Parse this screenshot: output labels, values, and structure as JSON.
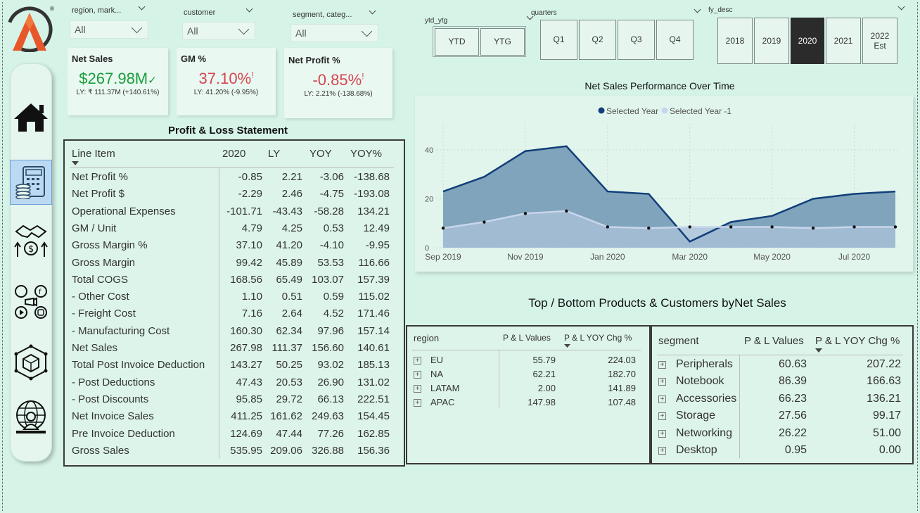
{
  "filters": {
    "region": {
      "label": "region, mark...",
      "value": "All"
    },
    "customer": {
      "label": "customer",
      "value": "All"
    },
    "segment": {
      "label": "segment, categ...",
      "value": "All"
    },
    "ytd_ytg": {
      "label": "ytd_ytg",
      "options": [
        "YTD",
        "YTG"
      ]
    },
    "quarters": {
      "label": "quarters",
      "options": [
        "Q1",
        "Q2",
        "Q3",
        "Q4"
      ]
    },
    "fy_desc": {
      "label": "fy_desc",
      "options": [
        "2018",
        "2019",
        "2020",
        "2021",
        "2022 Est"
      ],
      "selected": "2020"
    }
  },
  "kpis": {
    "net_sales": {
      "title": "Net Sales",
      "value": "$267.98M",
      "status": "✓",
      "ly": "LY: ₹ 111.37M (+140.61%)",
      "color": "#1a9d3c"
    },
    "gm_pct": {
      "title": "GM %",
      "value": "37.10%",
      "status": "!",
      "ly": "LY: 41.20% (-9.95%)",
      "color": "#d64550"
    },
    "net_profit_pct": {
      "title": "Net Profit %",
      "value": "-0.85%",
      "status": "!",
      "ly": "LY: 2.21% (-138.68%)",
      "color": "#d64550"
    }
  },
  "pl": {
    "title": "Profit & Loss Statement",
    "headers": [
      "Line Item",
      "2020",
      "LY",
      "YOY",
      "YOY%"
    ],
    "rows": [
      [
        "Net Profit %",
        "-0.85",
        "2.21",
        "-3.06",
        "-138.68"
      ],
      [
        "Net Profit $",
        "-2.29",
        "2.46",
        "-4.75",
        "-193.08"
      ],
      [
        "Operational Expenses",
        "-101.71",
        "-43.43",
        "-58.28",
        "134.21"
      ],
      [
        "GM / Unit",
        "4.79",
        "4.25",
        "0.53",
        "12.49"
      ],
      [
        "Gross Margin %",
        "37.10",
        "41.20",
        "-4.10",
        "-9.95"
      ],
      [
        "Gross Margin",
        "99.42",
        "45.89",
        "53.53",
        "116.66"
      ],
      [
        "Total COGS",
        "168.56",
        "65.49",
        "103.07",
        "157.39"
      ],
      [
        "- Other Cost",
        "1.10",
        "0.51",
        "0.59",
        "115.02"
      ],
      [
        "- Freight Cost",
        "7.16",
        "2.64",
        "4.52",
        "171.46"
      ],
      [
        "- Manufacturing Cost",
        "160.30",
        "62.34",
        "97.96",
        "157.14"
      ],
      [
        "Net Sales",
        "267.98",
        "111.37",
        "156.60",
        "140.61"
      ],
      [
        "Total Post Invoice Deduction",
        "143.27",
        "50.25",
        "93.02",
        "185.13"
      ],
      [
        "- Post Deductions",
        "47.43",
        "20.53",
        "26.90",
        "131.02"
      ],
      [
        "- Post Discounts",
        "95.85",
        "29.72",
        "66.13",
        "222.51"
      ],
      [
        "Net Invoice Sales",
        "411.25",
        "161.62",
        "249.63",
        "154.45"
      ],
      [
        "Pre Invoice Deduction",
        "124.69",
        "47.44",
        "77.26",
        "162.85"
      ],
      [
        "Gross Sales",
        "535.95",
        "209.06",
        "326.88",
        "156.36"
      ]
    ]
  },
  "chart_title": "Net Sales Performance Over Time",
  "chart_data": {
    "type": "area",
    "title": "Net Sales Performance Over Time",
    "x": [
      "Sep 2019",
      "Oct 2019",
      "Nov 2019",
      "Dec 2019",
      "Jan 2020",
      "Feb 2020",
      "Mar 2020",
      "Apr 2020",
      "May 2020",
      "Jun 2020",
      "Jul 2020",
      "Aug 2020"
    ],
    "x_tick_labels": [
      "Sep 2019",
      "Nov 2019",
      "Jan 2020",
      "Mar 2020",
      "May 2020",
      "Jul 2020"
    ],
    "y_ticks": [
      0,
      20,
      40
    ],
    "ylim": [
      0,
      50
    ],
    "legend_position": "top-center",
    "series": [
      {
        "name": "Selected Year",
        "color": "#123f7a",
        "values": [
          23,
          29,
          39.5,
          41.5,
          23,
          22,
          2.5,
          10.5,
          13,
          20,
          22,
          23
        ]
      },
      {
        "name": "Selected Year -1",
        "color": "#c7d6ec",
        "values": [
          8,
          10.5,
          14,
          15,
          8.5,
          8,
          8.5,
          8.5,
          8.5,
          8,
          8.5,
          8.5
        ]
      }
    ]
  },
  "bottom_title": "Top / Bottom Products & Customers byNet Sales",
  "region_table": {
    "headers": [
      "region",
      "P & L Values",
      "P & L YOY Chg %"
    ],
    "rows": [
      [
        "EU",
        "55.79",
        "224.03"
      ],
      [
        "NA",
        "62.21",
        "182.70"
      ],
      [
        "LATAM",
        "2.00",
        "141.89"
      ],
      [
        "APAC",
        "147.98",
        "107.48"
      ]
    ]
  },
  "segment_table": {
    "headers": [
      "segment",
      "P & L Values",
      "P & L YOY Chg %"
    ],
    "rows": [
      [
        "Peripherals",
        "60.63",
        "207.22"
      ],
      [
        "Notebook",
        "86.39",
        "166.63"
      ],
      [
        "Accessories",
        "66.23",
        "136.21"
      ],
      [
        "Storage",
        "27.56",
        "99.17"
      ],
      [
        "Networking",
        "26.22",
        "51.00"
      ],
      [
        "Desktop",
        "0.95",
        "0.00"
      ]
    ]
  },
  "nav": [
    "home-icon",
    "finance-calculator-icon",
    "sales-handshake-icon",
    "marketing-social-icon",
    "supply-chain-box-icon",
    "executive-globe-icon"
  ],
  "logo": {
    "mark": "®"
  }
}
